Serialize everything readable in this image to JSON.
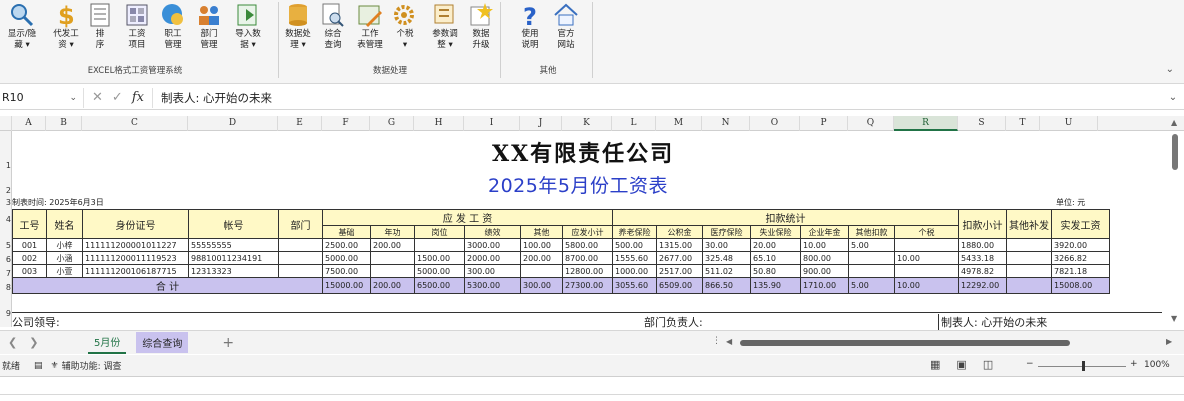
{
  "ribbon": {
    "buttons": [
      {
        "label": "显示/隐\n藏 ▾",
        "icon": "magnifier-icon"
      },
      {
        "label": "代发工\n资 ▾",
        "icon": "dollar-icon"
      },
      {
        "label": "排\n序",
        "icon": "sort-list-icon"
      },
      {
        "label": "工资\n项目",
        "icon": "salary-items-icon"
      },
      {
        "label": "职工\n管理",
        "icon": "employee-globe-icon"
      },
      {
        "label": "部门\n管理",
        "icon": "department-people-icon"
      },
      {
        "label": "导入数\n据 ▾",
        "icon": "import-data-icon"
      },
      {
        "label": "数据处\n理 ▾",
        "icon": "database-icon"
      },
      {
        "label": "综合\n查询",
        "icon": "search-document-icon"
      },
      {
        "label": "工作\n表管理",
        "icon": "worksheet-manage-icon"
      },
      {
        "label": "个税\n▾",
        "icon": "gear-icon"
      },
      {
        "label": "参数调\n整 ▾",
        "icon": "parameter-adjust-icon"
      },
      {
        "label": "数据\n升级",
        "icon": "data-upgrade-star-icon"
      },
      {
        "label": "使用\n说明",
        "icon": "help-question-icon"
      },
      {
        "label": "官方\n网站",
        "icon": "home-website-icon"
      }
    ],
    "groups": [
      "EXCEL格式工资管理系统",
      "数据处理",
      "其他"
    ]
  },
  "formula_bar": {
    "name_box": "R10",
    "fx": "fx",
    "content": "制表人: 心开始の未来"
  },
  "columns": [
    "A",
    "B",
    "C",
    "D",
    "E",
    "F",
    "G",
    "H",
    "I",
    "J",
    "K",
    "L",
    "M",
    "N",
    "O",
    "P",
    "Q",
    "R",
    "S",
    "T",
    "U"
  ],
  "rows": [
    "1",
    "2",
    "3",
    "4",
    "5",
    "6",
    "7",
    "8",
    "9"
  ],
  "sheet": {
    "title": "XX有限责任公司",
    "subtitle": "2025年5月份工资表",
    "made_time": "制表时间: 2025年6月3日",
    "unit": "单位: 元",
    "headers": {
      "emp_id": "工号",
      "name": "姓名",
      "id_card": "身份证号",
      "account": "帐号",
      "dept": "部门",
      "payable": "应 发 工 资",
      "deductions": "扣款统计",
      "other_bonus": "其他补发",
      "net_pay": "实发工资",
      "sub": [
        "基础",
        "年功",
        "岗位",
        "绩效",
        "其他",
        "应发小计",
        "养老保险",
        "公积金",
        "医疗保险",
        "失业保险",
        "企业年金",
        "其他扣款",
        "个税",
        "扣款小计"
      ]
    },
    "rows": [
      {
        "emp_id": "001",
        "name": "小梓",
        "id_card": "111111200001011227",
        "account": "55555555",
        "dept": "",
        "vals": [
          "2500.00",
          "200.00",
          "",
          "3000.00",
          "100.00",
          "5800.00",
          "500.00",
          "1315.00",
          "30.00",
          "20.00",
          "10.00",
          "5.00",
          "",
          "1880.00",
          "",
          "3920.00"
        ]
      },
      {
        "emp_id": "002",
        "name": "小涵",
        "id_card": "111111200011119523",
        "account": "98810011234191",
        "dept": "",
        "vals": [
          "5000.00",
          "",
          "1500.00",
          "2000.00",
          "200.00",
          "8700.00",
          "1555.60",
          "2677.00",
          "325.48",
          "65.10",
          "800.00",
          "",
          "10.00",
          "5433.18",
          "",
          "3266.82"
        ]
      },
      {
        "emp_id": "003",
        "name": "小萱",
        "id_card": "111111200106187715",
        "account": "12313323",
        "dept": "",
        "vals": [
          "7500.00",
          "",
          "5000.00",
          "300.00",
          "",
          "12800.00",
          "1000.00",
          "2517.00",
          "511.02",
          "50.80",
          "900.00",
          "",
          "",
          "4978.82",
          "",
          "7821.18"
        ]
      }
    ],
    "total_label": "合 计",
    "total_vals": [
      "15000.00",
      "200.00",
      "6500.00",
      "5300.00",
      "300.00",
      "27300.00",
      "3055.60",
      "6509.00",
      "866.50",
      "135.90",
      "1710.00",
      "5.00",
      "10.00",
      "12292.00",
      "",
      "15008.00"
    ],
    "signatures": {
      "leader": "公司领导:",
      "dept_head": "部门负责人:",
      "maker": "制表人: 心开始の未来"
    }
  },
  "tabs": {
    "sheets": [
      "5月份",
      "综合查询"
    ],
    "add": "+"
  },
  "status": {
    "ready": "就绪",
    "accessibility": "辅助功能: 调查",
    "zoom": "100%",
    "zoom_minus": "−",
    "zoom_plus": "+"
  }
}
